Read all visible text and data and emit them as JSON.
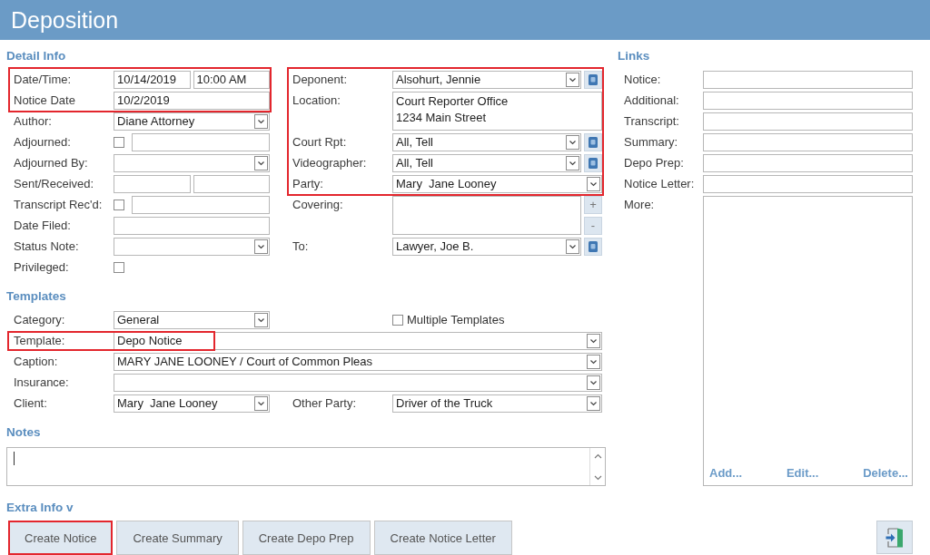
{
  "window": {
    "title": "Deposition"
  },
  "detail_info": {
    "heading": "Detail Info",
    "left_fields": [
      {
        "label": "Date/Time:",
        "kind": "pair",
        "values": [
          "10/14/2019",
          "10:00 AM"
        ],
        "highlighted": true
      },
      {
        "label": "Notice Date",
        "kind": "text",
        "value": "10/2/2019",
        "highlighted": true
      },
      {
        "label": "Author:",
        "kind": "dropdown",
        "value": "Diane Attorney",
        "highlighted": false
      },
      {
        "label": "Adjourned:",
        "kind": "check_text",
        "checked": false,
        "highlighted": false
      },
      {
        "label": "Adjourned By:",
        "kind": "dropdown",
        "highlighted": false
      },
      {
        "label": "Sent/Received:",
        "kind": "pair",
        "highlighted": false
      },
      {
        "label": "Transcript Rec'd:",
        "kind": "check_text",
        "checked": false,
        "highlighted": false
      },
      {
        "label": "Date Filed:",
        "kind": "text",
        "highlighted": false
      },
      {
        "label": "Status Note:",
        "kind": "dropdown",
        "highlighted": false
      },
      {
        "label": "Privileged:",
        "kind": "check",
        "checked": false,
        "highlighted": false
      }
    ],
    "right_fields": [
      {
        "label": "Deponent:",
        "kind": "lookup",
        "value": "Alsohurt, Jennie",
        "highlighted": true
      },
      {
        "label": "Location:",
        "kind": "memo",
        "lines": [
          "Court Reporter Office",
          "1234 Main Street"
        ],
        "highlighted": true
      },
      {
        "label": "Court Rpt:",
        "kind": "lookup",
        "value": "All, Tell",
        "highlighted": true
      },
      {
        "label": "Videographer:",
        "kind": "lookup",
        "value": "All, Tell",
        "highlighted": true
      },
      {
        "label": "Party:",
        "kind": "dropdown",
        "value": "Mary  Jane Looney",
        "highlighted": true
      },
      {
        "label": "Covering:",
        "kind": "list_edit",
        "buttons": [
          "+",
          "-"
        ],
        "highlighted": false
      },
      {
        "label": "To:",
        "kind": "lookup",
        "value": "Lawyer, Joe B.",
        "highlighted": false
      }
    ]
  },
  "links": {
    "heading": "Links",
    "fields": [
      {
        "label": "Notice:"
      },
      {
        "label": "Additional:"
      },
      {
        "label": "Transcript:"
      },
      {
        "label": "Summary:"
      },
      {
        "label": "Depo Prep:"
      },
      {
        "label": "Notice Letter:"
      }
    ],
    "more": {
      "label": "More:",
      "actions": [
        "Add...",
        "Edit...",
        "Delete..."
      ]
    }
  },
  "templates": {
    "heading": "Templates",
    "category": {
      "label": "Category:",
      "value": "General"
    },
    "multiple_templates": {
      "label": "Multiple Templates",
      "checked": false
    },
    "lines": [
      {
        "label": "Template:",
        "value": "Depo Notice",
        "highlighted": true
      },
      {
        "label": "Caption:",
        "value": "MARY JANE LOONEY / Court of Common Pleas",
        "highlighted": false
      },
      {
        "label": "Insurance:",
        "highlighted": false
      }
    ],
    "client": {
      "label": "Client:",
      "value": "Mary  Jane Looney"
    },
    "other_party": {
      "label": "Other Party:",
      "value": "Driver of the Truck"
    }
  },
  "notes": {
    "heading": "Notes"
  },
  "extra_info": {
    "heading": "Extra Info v",
    "buttons": [
      {
        "label": "Create Notice",
        "highlighted": true
      },
      {
        "label": "Create Summary",
        "highlighted": false
      },
      {
        "label": "Create Depo Prep",
        "highlighted": false
      },
      {
        "label": "Create Notice Letter",
        "highlighted": false
      }
    ]
  }
}
